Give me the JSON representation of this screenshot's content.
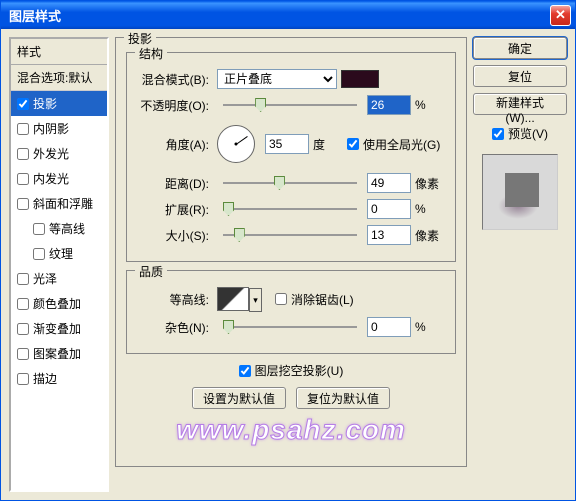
{
  "window": {
    "title": "图层样式"
  },
  "styles": {
    "header": "样式",
    "blend": "混合选项:默认",
    "items": [
      {
        "label": "投影",
        "checked": true,
        "selected": true
      },
      {
        "label": "内阴影",
        "checked": false
      },
      {
        "label": "外发光",
        "checked": false
      },
      {
        "label": "内发光",
        "checked": false
      },
      {
        "label": "斜面和浮雕",
        "checked": false
      },
      {
        "label": "等高线",
        "checked": false,
        "indent": true
      },
      {
        "label": "纹理",
        "checked": false,
        "indent": true
      },
      {
        "label": "光泽",
        "checked": false
      },
      {
        "label": "颜色叠加",
        "checked": false
      },
      {
        "label": "渐变叠加",
        "checked": false
      },
      {
        "label": "图案叠加",
        "checked": false
      },
      {
        "label": "描边",
        "checked": false
      }
    ]
  },
  "panel": {
    "title": "投影",
    "structure": {
      "legend": "结构",
      "blend_mode_label": "混合模式(B):",
      "blend_mode_value": "正片叠底",
      "color": "#2B0A1C",
      "opacity_label": "不透明度(O):",
      "opacity_value": "26",
      "opacity_unit": "%",
      "angle_label": "角度(A):",
      "angle_value": "35",
      "angle_unit": "度",
      "global_light": "使用全局光(G)",
      "global_light_checked": true,
      "distance_label": "距离(D):",
      "distance_value": "49",
      "distance_unit": "像素",
      "spread_label": "扩展(R):",
      "spread_value": "0",
      "spread_unit": "%",
      "size_label": "大小(S):",
      "size_value": "13",
      "size_unit": "像素"
    },
    "quality": {
      "legend": "品质",
      "contour_label": "等高线:",
      "anti_alias": "消除锯齿(L)",
      "anti_alias_checked": false,
      "noise_label": "杂色(N):",
      "noise_value": "0",
      "noise_unit": "%"
    },
    "knockout": {
      "label": "图层挖空投影(U)",
      "checked": true
    },
    "set_default": "设置为默认值",
    "reset_default": "复位为默认值"
  },
  "buttons": {
    "ok": "确定",
    "cancel": "复位",
    "new_style": "新建样式(W)...",
    "preview": "预览(V)"
  },
  "watermark": "www.psahz.com"
}
